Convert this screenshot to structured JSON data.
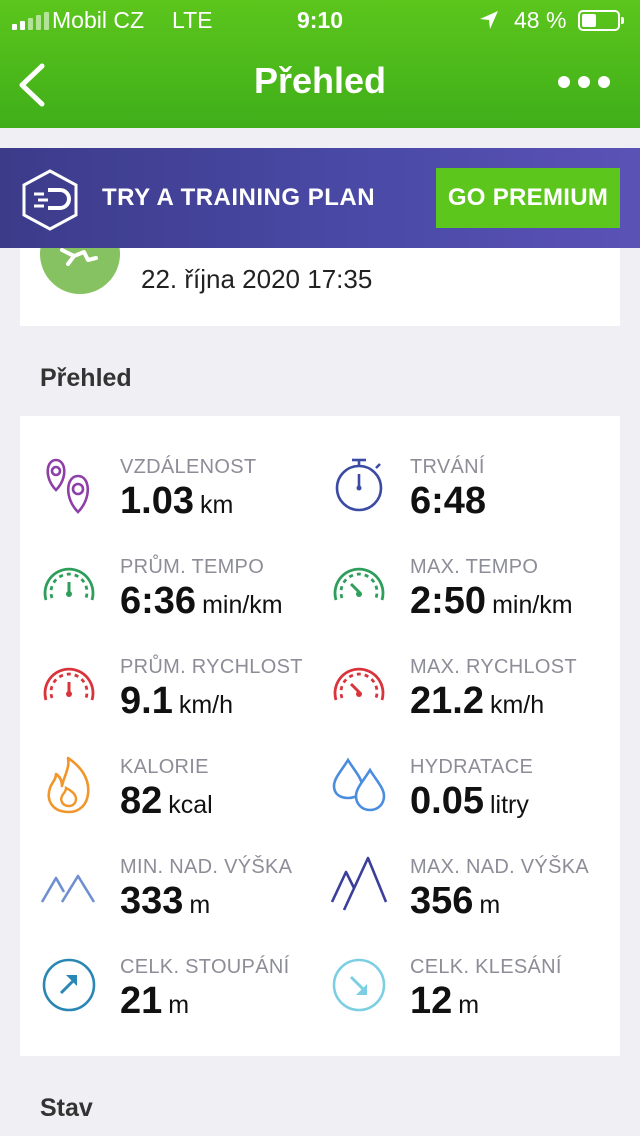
{
  "status_bar": {
    "carrier": "Mobil CZ",
    "network": "LTE",
    "time": "9:10",
    "battery": "48 %",
    "battery_level": 0.48
  },
  "nav": {
    "title": "Přehled",
    "back_icon": "chevron-left-icon",
    "more_icon": "more-dots-icon"
  },
  "promo": {
    "text": "TRY A TRAINING PLAN",
    "button": "GO PREMIUM",
    "icon": "premium-shield-icon"
  },
  "activity": {
    "date": "22. října 2020 17:35",
    "icon": "running-icon"
  },
  "overview": {
    "title": "Přehled",
    "stats": [
      {
        "label": "VZDÁLENOST",
        "value": "1.03",
        "unit": "km",
        "icon": "distance-pins-icon",
        "color": "#8e3fa8"
      },
      {
        "label": "TRVÁNÍ",
        "value": "6:48",
        "unit": "",
        "icon": "stopwatch-icon",
        "color": "#3b4aa3"
      },
      {
        "label": "PRŮM. TEMPO",
        "value": "6:36",
        "unit": "min/km",
        "icon": "gauge-icon",
        "color": "#2e9e5b"
      },
      {
        "label": "MAX. TEMPO",
        "value": "2:50",
        "unit": "min/km",
        "icon": "gauge-icon",
        "color": "#2e9e5b"
      },
      {
        "label": "PRŮM. RYCHLOST",
        "value": "9.1",
        "unit": "km/h",
        "icon": "gauge-icon",
        "color": "#d9343b"
      },
      {
        "label": "MAX. RYCHLOST",
        "value": "21.2",
        "unit": "km/h",
        "icon": "gauge-icon",
        "color": "#d9343b"
      },
      {
        "label": "KALORIE",
        "value": "82",
        "unit": "kcal",
        "icon": "flame-icon",
        "color": "#f0962a"
      },
      {
        "label": "HYDRATACE",
        "value": "0.05",
        "unit": "litry",
        "icon": "water-drops-icon",
        "color": "#4a8de0"
      },
      {
        "label": "MIN. NAD. VÝŠKA",
        "value": "333",
        "unit": "m",
        "icon": "mountains-icon",
        "color": "#6f8fd0"
      },
      {
        "label": "MAX. NAD. VÝŠKA",
        "value": "356",
        "unit": "m",
        "icon": "mountains-icon",
        "color": "#3b3f9a"
      },
      {
        "label": "CELK. STOUPÁNÍ",
        "value": "21",
        "unit": "m",
        "icon": "arrow-up-right-circle-icon",
        "color": "#2a86b5"
      },
      {
        "label": "CELK. KLESÁNÍ",
        "value": "12",
        "unit": "m",
        "icon": "arrow-down-right-circle-icon",
        "color": "#7ccfe3"
      }
    ]
  },
  "next_section": {
    "title": "Stav"
  }
}
